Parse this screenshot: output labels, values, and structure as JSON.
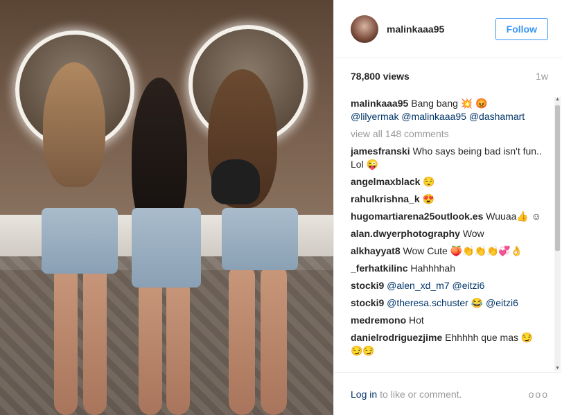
{
  "post": {
    "username": "malinkaaa95",
    "follow_label": "Follow",
    "views": "78,800 views",
    "age": "1w",
    "view_all": "view all 148 comments",
    "caption": {
      "user": "malinkaaa95",
      "text": "Bang bang 💥 😡",
      "mentions": "@lilyermak @malinkaaa95 @dashamart"
    },
    "comments": [
      {
        "user": "jamesfranski",
        "text": "Who says being bad isn't fun.. Lol 😜"
      },
      {
        "user": "angelmaxblack",
        "text": "😌"
      },
      {
        "user": "rahulkrishna_k",
        "text": "😍"
      },
      {
        "user": "hugomartiarena25outlook.es",
        "text": "Wuuaa👍 ☺"
      },
      {
        "user": "alan.dwyerphotography",
        "text": "Wow"
      },
      {
        "user": "alkhayyat8",
        "text": "Wow Cute 🍑👏👏👏💞👌"
      },
      {
        "user": "_ferhatkilinc",
        "text": "Hahhhhah"
      },
      {
        "user": "stocki9",
        "text": "@alen_xd_m7 @eitzi6"
      },
      {
        "user": "stocki9",
        "text": "@theresa.schuster 😂 @eitzi6"
      },
      {
        "user": "medremono",
        "text": "Hot"
      },
      {
        "user": "danielrodriguezjime",
        "text": "Ehhhhh que mas 😏 😏😏"
      }
    ],
    "footer": {
      "login": "Log in",
      "rest": "to like or comment.",
      "more": "ooo"
    }
  },
  "colors": {
    "accent": "#3897f0",
    "link": "#003569",
    "muted": "#999999"
  },
  "icons": {
    "more": "more-options-icon"
  }
}
